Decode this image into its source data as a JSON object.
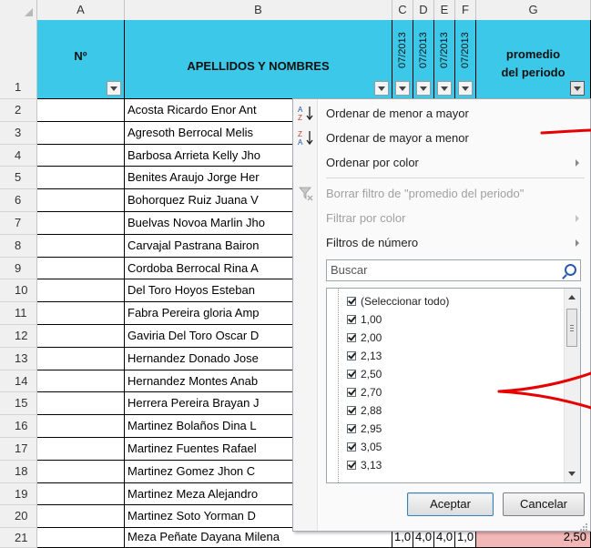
{
  "columns": [
    "A",
    "B",
    "C",
    "D",
    "E",
    "F",
    "G"
  ],
  "header_row": {
    "row_number": "1",
    "col_a": "Nº",
    "col_b": "APELLIDOS Y NOMBRES",
    "col_c": "07/2013",
    "col_d": "07/2013",
    "col_e": "07/2013",
    "col_f": "07/2013",
    "col_g_line1": "promedio",
    "col_g_line2": "del periodo"
  },
  "rows": [
    {
      "n": "2",
      "name": "Acosta Ricardo Enor Ant"
    },
    {
      "n": "3",
      "name": "Agresoth Berrocal  Melis"
    },
    {
      "n": "4",
      "name": "Barbosa Arrieta Kelly Jho"
    },
    {
      "n": "5",
      "name": "Benites Araujo Jorge Her"
    },
    {
      "n": "6",
      "name": "Bohorquez Ruiz Juana V"
    },
    {
      "n": "7",
      "name": "Buelvas Novoa Marlin Jho"
    },
    {
      "n": "8",
      "name": "Carvajal Pastrana Bairon"
    },
    {
      "n": "9",
      "name": "Cordoba Berrocal Rina A"
    },
    {
      "n": "10",
      "name": "Del Toro Hoyos Esteban"
    },
    {
      "n": "11",
      "name": "Fabra Pereira gloria Amp"
    },
    {
      "n": "12",
      "name": "Gaviria Del Toro Oscar D"
    },
    {
      "n": "13",
      "name": "Hernandez Donado Jose"
    },
    {
      "n": "14",
      "name": "Hernandez Montes Anab"
    },
    {
      "n": "15",
      "name": "Herrera Pereira Brayan J"
    },
    {
      "n": "16",
      "name": "Martinez Bolaños Dina L"
    },
    {
      "n": "17",
      "name": "Martinez Fuentes Rafael"
    },
    {
      "n": "18",
      "name": "Martinez Gomez Jhon C"
    },
    {
      "n": "19",
      "name": "Martinez Meza Alejandro"
    },
    {
      "n": "20",
      "name": "Martinez Soto Yorman D"
    }
  ],
  "last_row": {
    "n": "21",
    "name": "Meza Peñate Dayana Milena",
    "c": "1,0",
    "d": "4,0",
    "e": "4,0",
    "f": "1,0",
    "g": "2,50"
  },
  "menu": {
    "sort_asc": "Ordenar de menor a mayor",
    "sort_desc": "Ordenar de mayor a menor",
    "sort_color": "Ordenar por color",
    "clear_filter": "Borrar filtro de \"promedio del periodo\"",
    "filter_color": "Filtrar por color",
    "number_filters": "Filtros de número",
    "search_placeholder": "Buscar",
    "list_items": [
      "(Seleccionar todo)",
      "1,00",
      "2,00",
      "2,13",
      "2,50",
      "2,70",
      "2,88",
      "2,95",
      "3,05",
      "3,13"
    ],
    "ok_label": "Aceptar",
    "cancel_label": "Cancelar"
  },
  "colors": {
    "header_fill": "#3cc8e8",
    "annotation_red": "#e60000",
    "highlight_cell": "#f2b8b8"
  }
}
